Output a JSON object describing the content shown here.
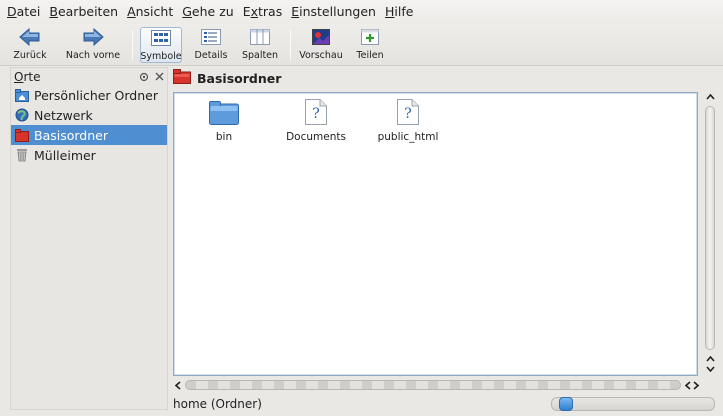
{
  "menubar": {
    "items": [
      {
        "mnemonic": "D",
        "rest": "atei"
      },
      {
        "mnemonic": "B",
        "rest": "earbeiten"
      },
      {
        "mnemonic": "A",
        "rest": "nsicht"
      },
      {
        "mnemonic": "G",
        "rest": "ehe zu"
      },
      {
        "pre": "E",
        "mnemonic": "x",
        "rest": "tras"
      },
      {
        "mnemonic": "E",
        "rest": "instellungen"
      },
      {
        "mnemonic": "H",
        "rest": "ilfe"
      }
    ]
  },
  "toolbar": {
    "back_label": "Zurück",
    "forward_label": "Nach vorne",
    "icons_label": "Symbole",
    "details_label": "Details",
    "columns_label": "Spalten",
    "preview_label": "Vorschau",
    "split_label": "Teilen"
  },
  "places": {
    "title_mnemonic": "O",
    "title_rest": "rte",
    "items": [
      {
        "label": "Persönlicher Ordner",
        "icon": "home-folder-icon"
      },
      {
        "label": "Netzwerk",
        "icon": "network-icon"
      },
      {
        "label": "Basisordner",
        "icon": "root-folder-icon",
        "selected": true
      },
      {
        "label": "Mülleimer",
        "icon": "trash-icon"
      }
    ]
  },
  "location": {
    "title": "Basisordner"
  },
  "files": [
    {
      "name": "bin",
      "icon": "folder-icon"
    },
    {
      "name": "Documents",
      "icon": "unknown-file-icon"
    },
    {
      "name": "public_html",
      "icon": "unknown-file-icon"
    }
  ],
  "status": {
    "text": "home (Ordner)",
    "zoom_level": 0.05
  },
  "colors": {
    "selection": "#4f8fd1",
    "accent_folder": "#d9342b"
  }
}
